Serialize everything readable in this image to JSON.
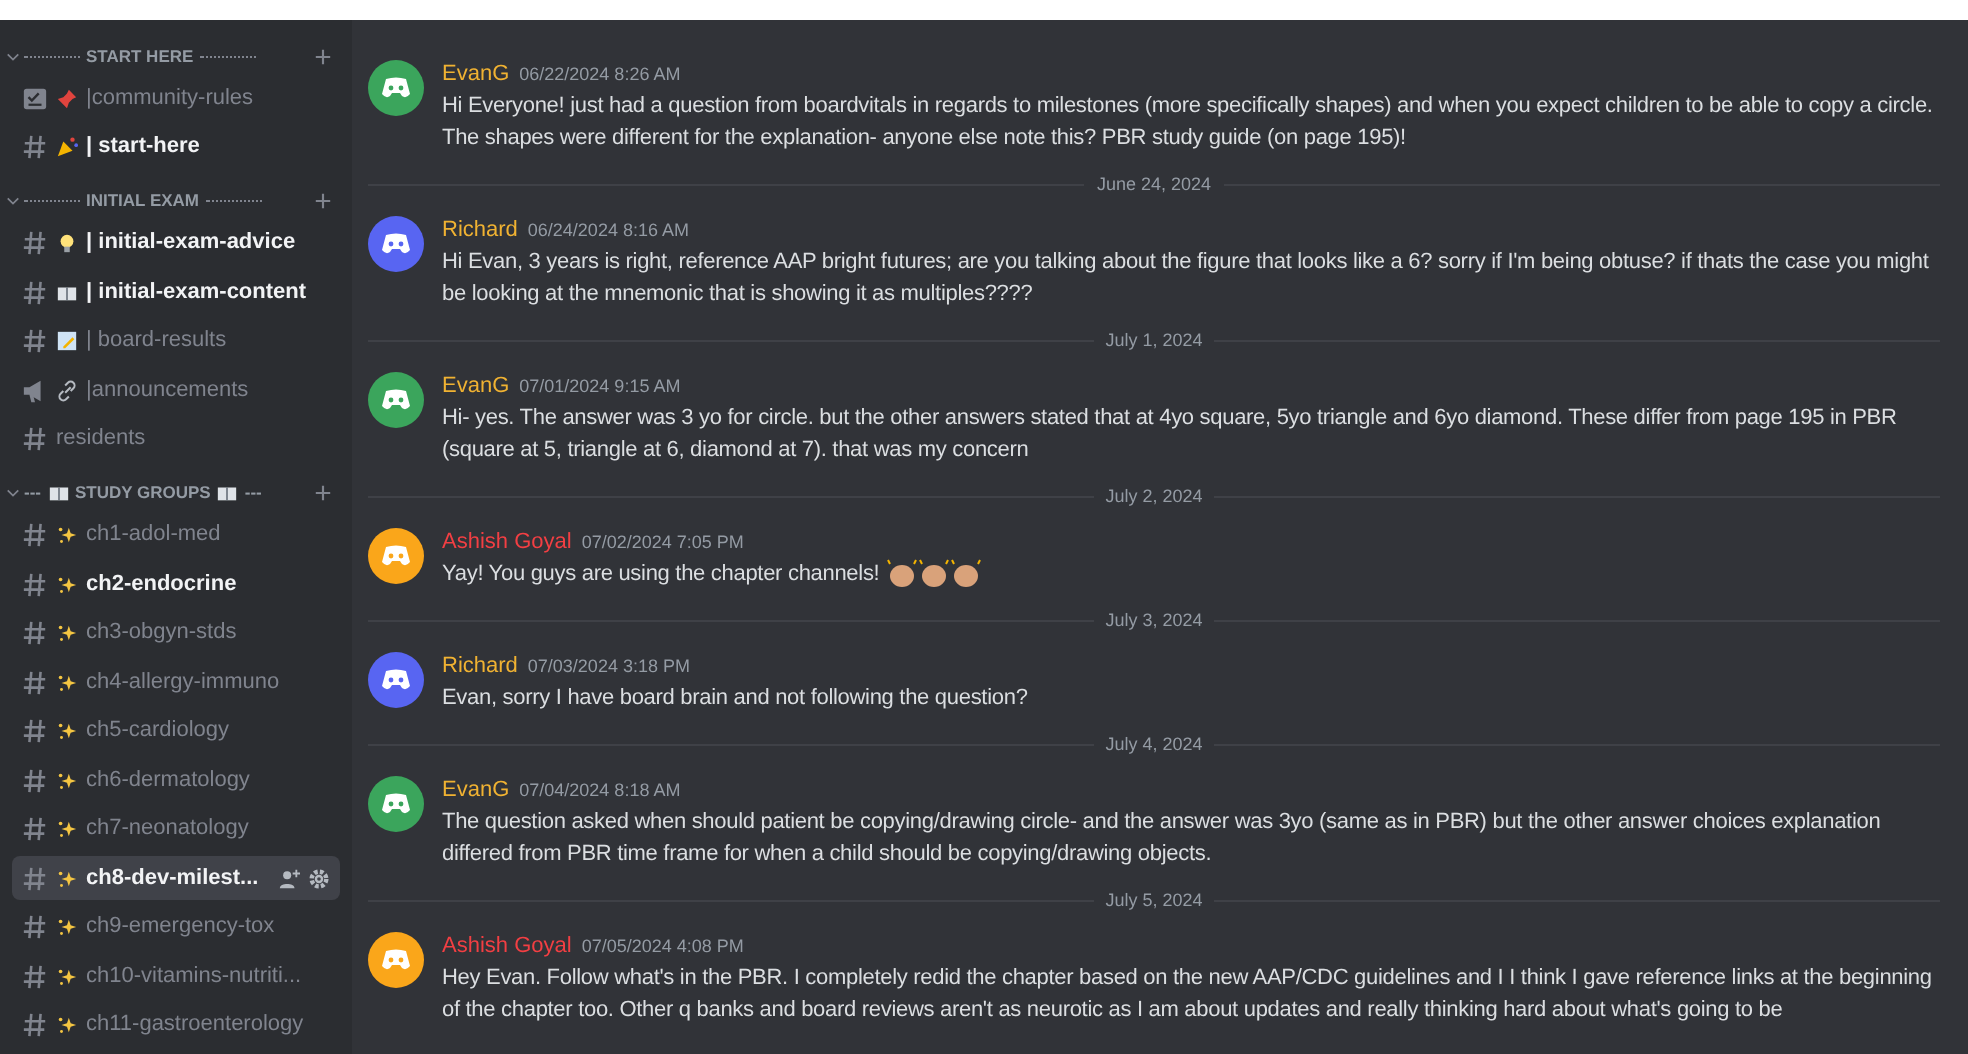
{
  "sidebar": {
    "sections": [
      {
        "title": "START HERE",
        "kind": "dotted",
        "channels": [
          {
            "kind": "rules",
            "label": "|community-rules",
            "unread": false,
            "selected": false
          },
          {
            "kind": "party",
            "label": "| start-here",
            "unread": true,
            "selected": false
          }
        ]
      },
      {
        "title": "INITIAL EXAM",
        "kind": "dotted",
        "channels": [
          {
            "kind": "bulb",
            "label": "| initial-exam-advice",
            "unread": true,
            "selected": false
          },
          {
            "kind": "book",
            "label": "| initial-exam-content",
            "unread": true,
            "selected": false
          },
          {
            "kind": "memo",
            "label": "| board-results",
            "unread": false,
            "selected": false
          },
          {
            "kind": "announce",
            "label": "|announcements",
            "unread": false,
            "selected": false
          },
          {
            "kind": "plain",
            "label": "residents",
            "unread": false,
            "selected": false
          }
        ]
      },
      {
        "title": "STUDY GROUPS",
        "kind": "book",
        "prefix": "---",
        "suffix": "---",
        "channels": [
          {
            "kind": "sparkle",
            "label": "ch1-adol-med",
            "unread": false,
            "selected": false
          },
          {
            "kind": "sparkle",
            "label": "ch2-endocrine",
            "unread": true,
            "selected": false
          },
          {
            "kind": "sparkle",
            "label": "ch3-obgyn-stds",
            "unread": false,
            "selected": false
          },
          {
            "kind": "sparkle",
            "label": "ch4-allergy-immuno",
            "unread": false,
            "selected": false
          },
          {
            "kind": "sparkle",
            "label": "ch5-cardiology",
            "unread": false,
            "selected": false
          },
          {
            "kind": "sparkle",
            "label": "ch6-dermatology",
            "unread": false,
            "selected": false
          },
          {
            "kind": "sparkle",
            "label": "ch7-neonatology",
            "unread": false,
            "selected": false
          },
          {
            "kind": "sparkle",
            "label": "ch8-dev-milest...",
            "unread": true,
            "selected": true
          },
          {
            "kind": "sparkle",
            "label": "ch9-emergency-tox",
            "unread": false,
            "selected": false
          },
          {
            "kind": "sparkle",
            "label": "ch10-vitamins-nutriti...",
            "unread": false,
            "selected": false
          },
          {
            "kind": "sparkle",
            "label": "ch11-gastroenterology",
            "unread": false,
            "selected": false
          }
        ]
      }
    ]
  },
  "messages": [
    {
      "kind": "message",
      "author": "EvanG",
      "owner": false,
      "color": "#3ba55c",
      "time": "06/22/2024 8:26 AM",
      "text": "Hi Everyone!  just had a question from boardvitals in regards to milestones (more specifically shapes) and when you expect children to be able to copy a circle. The shapes were different for the explanation- anyone else note this?  PBR study guide (on page 195)!"
    },
    {
      "kind": "divider",
      "text": "June 24, 2024"
    },
    {
      "kind": "message",
      "author": "Richard",
      "owner": false,
      "color": "#5865f2",
      "time": "06/24/2024 8:16 AM",
      "text": "Hi Evan,    3 years is right, reference AAP bright futures;   are you talking about the figure that looks like a 6?  sorry if I'm being obtuse?  if thats the case you might be looking at the mnemonic that is showing it as multiples????"
    },
    {
      "kind": "divider",
      "text": "July 1, 2024"
    },
    {
      "kind": "message",
      "author": "EvanG",
      "owner": false,
      "color": "#3ba55c",
      "time": "07/01/2024 9:15 AM",
      "text": "Hi- yes. The answer was 3 yo for circle. but the other answers stated that at 4yo square, 5yo triangle and 6yo diamond. These differ from page 195 in PBR (square at 5, triangle at 6, diamond at 7). that was my concern"
    },
    {
      "kind": "divider",
      "text": "July 2, 2024"
    },
    {
      "kind": "message",
      "author": "Ashish Goyal",
      "owner": true,
      "color": "#faa61a",
      "time": "07/02/2024 7:05 PM",
      "text": "Yay! You guys are using the chapter channels!",
      "clap_emoji": true
    },
    {
      "kind": "divider",
      "text": "July 3, 2024"
    },
    {
      "kind": "message",
      "author": "Richard",
      "owner": false,
      "color": "#5865f2",
      "time": "07/03/2024 3:18 PM",
      "text": "Evan, sorry I have board brain and not following the question?"
    },
    {
      "kind": "divider",
      "text": "July 4, 2024"
    },
    {
      "kind": "message",
      "author": "EvanG",
      "owner": false,
      "color": "#3ba55c",
      "time": "07/04/2024 8:18 AM",
      "text": "The question asked when should patient be copying/drawing circle- and the answer was 3yo (same as in PBR) but the other answer choices explanation differed from PBR time frame for when a child should be copying/drawing objects."
    },
    {
      "kind": "divider",
      "text": "July 5, 2024"
    },
    {
      "kind": "message",
      "author": "Ashish Goyal",
      "owner": true,
      "color": "#faa61a",
      "time": "07/05/2024 4:08 PM",
      "text": "Hey Evan. Follow what's in the PBR. I completely redid the chapter based on the new AAP/CDC guidelines and I I think I gave reference links at the beginning of the chapter too. Other q banks and board reviews aren't as neurotic as I am about updates and really thinking hard about what's going to be"
    }
  ]
}
